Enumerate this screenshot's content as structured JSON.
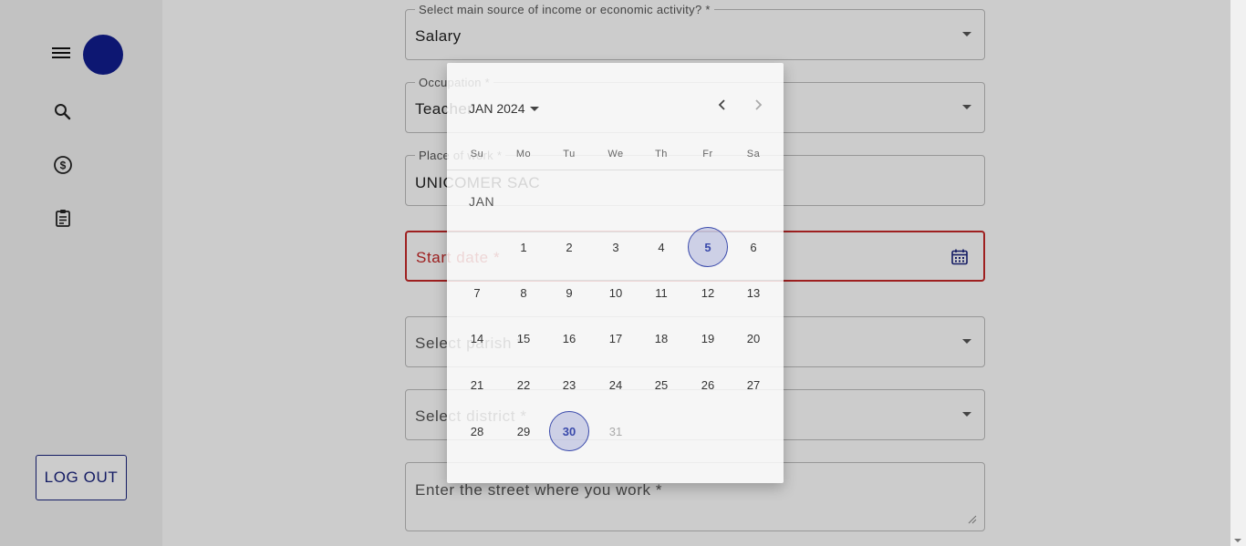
{
  "sidebar": {
    "menu_icon": "menu-icon",
    "avatar_color": "#111d8f",
    "nav_icons": [
      "search-icon",
      "dollar-circle-icon",
      "clipboard-icon"
    ],
    "logout_label": "LOG OUT"
  },
  "form": {
    "income_source": {
      "label": "Select main source of income or economic activity? *",
      "value": "Salary"
    },
    "occupation": {
      "label": "Occupation *",
      "value": "Teacher"
    },
    "place_of_work": {
      "label": "Place of work *",
      "value": "UNICOMER SAC"
    },
    "start_date": {
      "placeholder": "Start date *",
      "icon": "calendar-icon"
    },
    "parish": {
      "placeholder": "Select parish *"
    },
    "district": {
      "placeholder": "Select district *"
    },
    "street": {
      "placeholder": "Enter the street where you work *"
    }
  },
  "datepicker": {
    "month_year": "JAN 2024",
    "weekdays": [
      "Su",
      "Mo",
      "Tu",
      "We",
      "Th",
      "Fr",
      "Sa"
    ],
    "month_label": "JAN",
    "weeks": [
      [
        "",
        "1",
        "2",
        "3",
        "4",
        "5",
        "6"
      ],
      [
        "7",
        "8",
        "9",
        "10",
        "11",
        "12",
        "13"
      ],
      [
        "14",
        "15",
        "16",
        "17",
        "18",
        "19",
        "20"
      ],
      [
        "21",
        "22",
        "23",
        "24",
        "25",
        "26",
        "27"
      ],
      [
        "28",
        "29",
        "30",
        "31",
        "",
        "",
        ""
      ]
    ],
    "highlighted_days": [
      "5",
      "30"
    ],
    "disabled_days": [
      "31"
    ],
    "accent_color": "#3949ab"
  }
}
